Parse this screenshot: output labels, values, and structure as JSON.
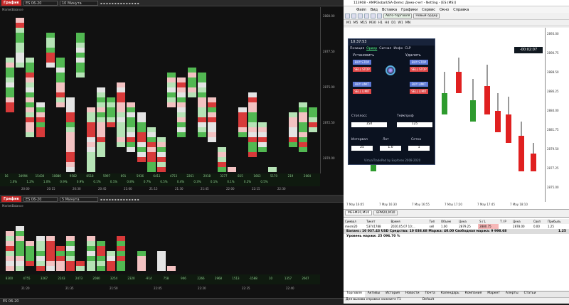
{
  "left": {
    "top": {
      "tag": "График",
      "symbol": "ES 06-20",
      "interval": "10 Минута",
      "label": "MarketBalance",
      "ticks": [
        "2880.00",
        "2877.50",
        "2875.00",
        "2872.50",
        "2870.00"
      ],
      "times": [
        "20:00",
        "20:15",
        "20:30",
        "20:45",
        "21:00",
        "21:15",
        "21:30",
        "21:45",
        "22:00",
        "22:15",
        "22:30"
      ],
      "vol": [
        "16",
        "34994",
        "15430",
        "10880",
        "9582",
        "8518",
        "5997",
        "691",
        "5936",
        "6411",
        "4753",
        "2261",
        "2018",
        "3277",
        "815",
        "1663",
        "5170",
        "219",
        "2664"
      ],
      "pct": [
        "1.0%",
        "1.2%",
        "1.0%",
        "0.9%",
        "0.9%",
        "0.1%",
        "0.1%",
        "0.8%",
        "0.7%",
        "0.5%",
        "0.4%",
        "0.3%",
        "0.1%",
        "0.1%",
        "0.2%",
        "0.5%"
      ]
    },
    "bottom": {
      "tag": "График",
      "symbol": "ES 06-20",
      "interval": "5 Минута",
      "label": "MarketBalance",
      "times": [
        "21:20",
        "21:35",
        "21:50",
        "22:05",
        "22:20",
        "22:35",
        "22:40"
      ],
      "vol": [
        "8300",
        "4755",
        "3267",
        "2243",
        "2473",
        "2080",
        "3254",
        "2320",
        "-914",
        "758",
        "906",
        "2266",
        "2968",
        "1513",
        "-1588",
        "10",
        "1357",
        "2607"
      ],
      "footer": "ES 06-20"
    }
  },
  "right": {
    "title": "113908 - AMPGlobalUSA-Demo: Демо-счет - Netting - [ES (MS)]",
    "menu": [
      "Файл",
      "Вид",
      "Вставка",
      "Графики",
      "Сервис",
      "Окно",
      "Справка"
    ],
    "autotrade": "Авто-торговля",
    "neworder": "Новый ордер",
    "tfs": [
      "M1",
      "M5",
      "M15",
      "M30",
      "H1",
      "H4",
      "D1",
      "W1",
      "MN"
    ],
    "panel": {
      "time": "10:37:53",
      "countdown": "-00:02:07",
      "tabs": [
        "Позиция",
        "Ордер",
        "Сигнал",
        "Инфо",
        "CLP"
      ],
      "set": "Установить",
      "del": "Удалить",
      "buy_stop": "BUY STOP",
      "sell_stop": "SELL STOP",
      "buy_limit": "BUY LIMIT",
      "sell_limit": "SELL LIMIT",
      "sl_label": "Стоплосс",
      "sl": "150",
      "tp_label": "Тейкпроф",
      "tp": "125",
      "interval_label": "Интервал",
      "interval": "25",
      "lot_label": "Лот",
      "lot": "1.0",
      "grid_label": "Сетка",
      "grid": "1",
      "footer": "VirtualTradePad by Expforex 2008-2020"
    },
    "prices": [
      "2893.00",
      "2890.75",
      "2888.50",
      "2886.25",
      "2884.00",
      "2881.75",
      "2879.50",
      "2877.25",
      "2875.00"
    ],
    "times": [
      "7 May 16:05",
      "7 May 16:30",
      "7 May 16:55",
      "7 May 17:20",
      "7 May 17:45",
      "7 May 18:10"
    ],
    "tab1": "MESM20,M10",
    "tab2": "EPM20,M10",
    "cols": [
      "Символ",
      "Тикет",
      "Время",
      "Тип",
      "Объем",
      "Цена",
      "S / L",
      "T / P",
      "Цена",
      "Своп",
      "Прибыль"
    ],
    "row": [
      "mesm20",
      "53741788",
      "2020.05.07 10:...",
      "sell",
      "1.00",
      "2879.25",
      "2880.75",
      "",
      "2878.00",
      "0.00",
      "1.25"
    ],
    "balance": "Баланс: 10 037.43 USD  Средства: 10 038.68  Маржа: 40.00  Свободная маржа: 9 998.68",
    "balance_val": "1.25",
    "level": "Уровень маржи: 25 096.70 %",
    "bottom_tabs": [
      "Торговля",
      "Активы",
      "История",
      "Новости",
      "Почта",
      "Календарь",
      "Компания",
      "Маркет",
      "Алерты",
      "Статьи"
    ],
    "status": "Для вызова справки нажмите F1",
    "status2": "Default"
  }
}
